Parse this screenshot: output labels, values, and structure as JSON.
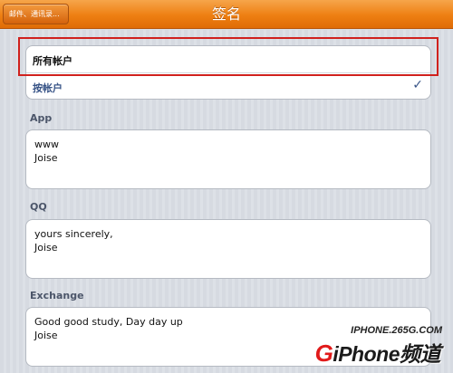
{
  "nav": {
    "back_label": "邮件、通讯录...",
    "title": "签名"
  },
  "accounts": {
    "all_label": "所有帐户",
    "per_label": "按帐户",
    "check_icon": "checkmark-icon"
  },
  "signatures": [
    {
      "label": "App",
      "lines": [
        "www",
        "Joise"
      ]
    },
    {
      "label": "QQ",
      "lines": [
        "yours sincerely,",
        "Joise"
      ]
    },
    {
      "label": "Exchange",
      "lines": [
        "Good good study, Day day up",
        "Joise"
      ]
    }
  ],
  "watermark": {
    "url": "IPHONE.265G.COM",
    "brand_g": "G",
    "brand_rest": "iPhone频道"
  },
  "colors": {
    "nav_orange": "#ee7f12",
    "highlight_red": "#d0211d",
    "check_blue": "#385487"
  }
}
